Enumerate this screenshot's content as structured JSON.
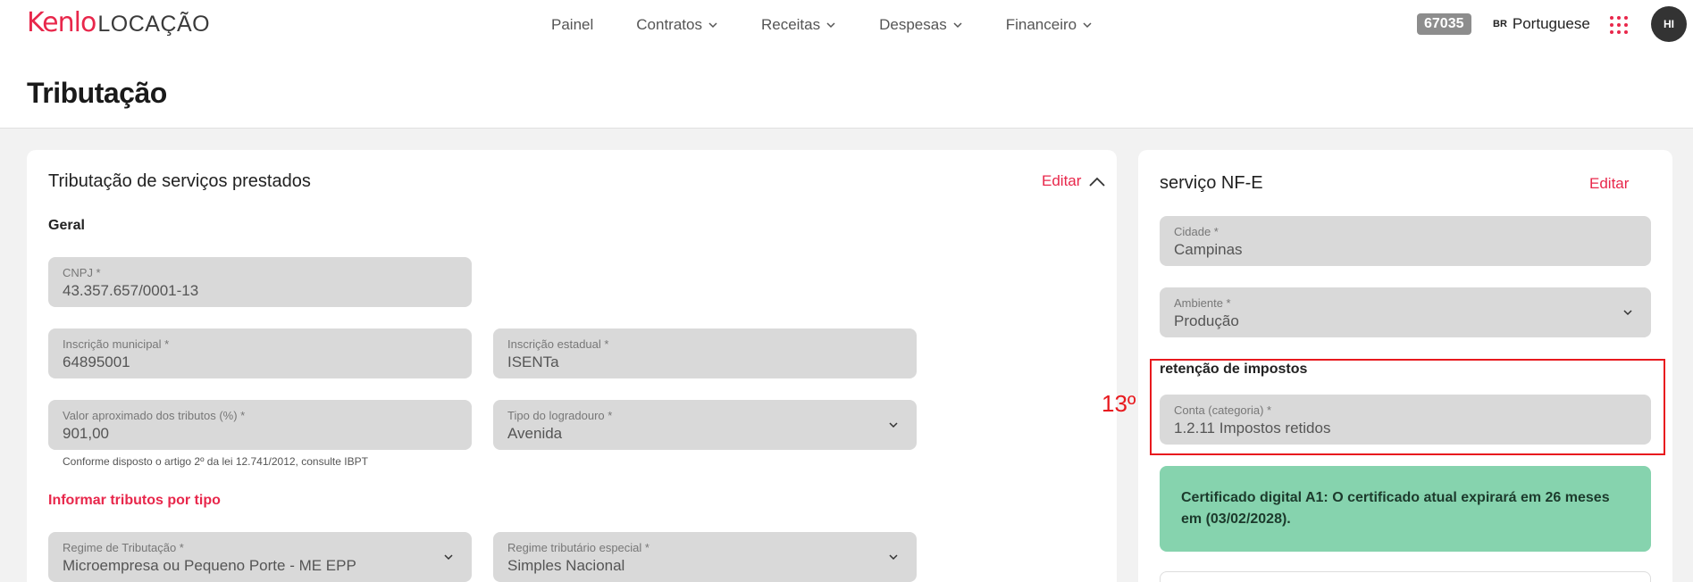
{
  "topbar": {
    "logo_brand": "Kenlo",
    "logo_product": "LOCAÇÃO",
    "nav": [
      {
        "label": "Painel"
      },
      {
        "label": "Contratos"
      },
      {
        "label": "Receitas"
      },
      {
        "label": "Despesas"
      },
      {
        "label": "Financeiro"
      }
    ],
    "badge": "67035",
    "lang_code": "BR",
    "lang_label": "Portuguese",
    "avatar": "HI"
  },
  "page": {
    "title": "Tributação"
  },
  "left_card": {
    "title": "Tributação de serviços prestados",
    "edit_label": "Editar",
    "section_geral": "Geral",
    "cnpj": {
      "label": "CNPJ *",
      "value": "43.357.657/0001-13"
    },
    "inscricao_municipal": {
      "label": "Inscrição municipal *",
      "value": "64895001"
    },
    "inscricao_estadual": {
      "label": "Inscrição estadual *",
      "value": "ISENTa"
    },
    "valor_tributos": {
      "label": "Valor aproximado dos tributos (%) *",
      "value": "901,00"
    },
    "tipo_logradouro": {
      "label": "Tipo do logradouro *",
      "value": "Avenida"
    },
    "hint": "Conforme disposto o artigo 2º da lei 12.741/2012, consulte IBPT",
    "section_tributos": "Informar tributos por tipo",
    "regime_tributacao": {
      "label": "Regime de Tributação *",
      "value": "Microempresa ou Pequeno Porte - ME EPP"
    },
    "regime_especial": {
      "label": "Regime tributário especial *",
      "value": "Simples Nacional"
    }
  },
  "right_card": {
    "title": "serviço NF-E",
    "edit_label": "Editar",
    "cidade": {
      "label": "Cidade *",
      "value": "Campinas"
    },
    "ambiente": {
      "label": "Ambiente *",
      "value": "Produção"
    },
    "section_retencao": "retenção de impostos",
    "conta": {
      "label": "Conta (categoria) *",
      "value": "1.2.11 Impostos retidos"
    },
    "certificado": "Certificado digital A1: O certificado atual expirará em 26 meses em (03/02/2028)."
  },
  "annotation": {
    "marker": "13º",
    "color": "#e8191e"
  },
  "colors": {
    "accent": "#e8274b",
    "field_bg": "#d9d9d9",
    "success_bg": "#86d3ae"
  }
}
